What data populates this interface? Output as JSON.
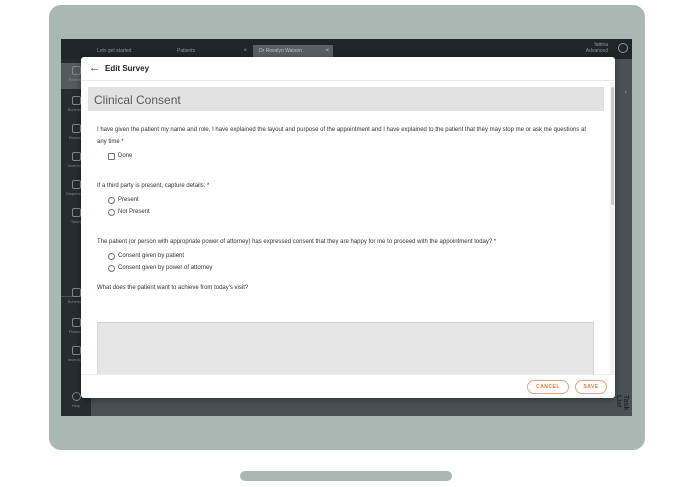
{
  "background_app": {
    "tabs": [
      {
        "label": "Lets get started"
      },
      {
        "label": "Patients",
        "close": "×"
      },
      {
        "label": "Dr Rosalyn Watson",
        "close": "×"
      }
    ],
    "user": {
      "line1": "fatima",
      "line2": "Advanced"
    },
    "sidebar": [
      {
        "label": "Patients"
      },
      {
        "label": "Schedule"
      },
      {
        "label": "Finance"
      },
      {
        "label": "Inventory"
      },
      {
        "label": "Dispensary"
      },
      {
        "label": "Tasks"
      },
      {
        "label": "Schedule"
      },
      {
        "label": "Finance"
      },
      {
        "label": "Inventory"
      },
      {
        "label": "Help"
      }
    ],
    "collapse_glyph": "‹",
    "task_list_label": "Task List"
  },
  "modal": {
    "back_glyph": "←",
    "title": "Edit Survey",
    "section_title": "Clinical Consent",
    "questions": [
      {
        "label": "I have given the patient my name and role, I have explained the layout and purpose of the appointment and I have explained to the patient that they may stop me or ask me questions at any time *",
        "options": [
          "Done"
        ]
      },
      {
        "label": "If a third party is present, capture details: *",
        "options": [
          "Present",
          "Not Present"
        ]
      },
      {
        "label": "The patient (or person with appropriate power of attorney) has expressed consent that they are happy for me to proceed with the appointment today? *",
        "options": [
          "Consent given by patient",
          "Consent given by power of attorney"
        ]
      },
      {
        "label": "What does the patient want to achieve from today's visit?",
        "value": ""
      }
    ],
    "resize_glyph": "◢",
    "cancel_label": "CANCEL",
    "save_label": "SAVE"
  }
}
